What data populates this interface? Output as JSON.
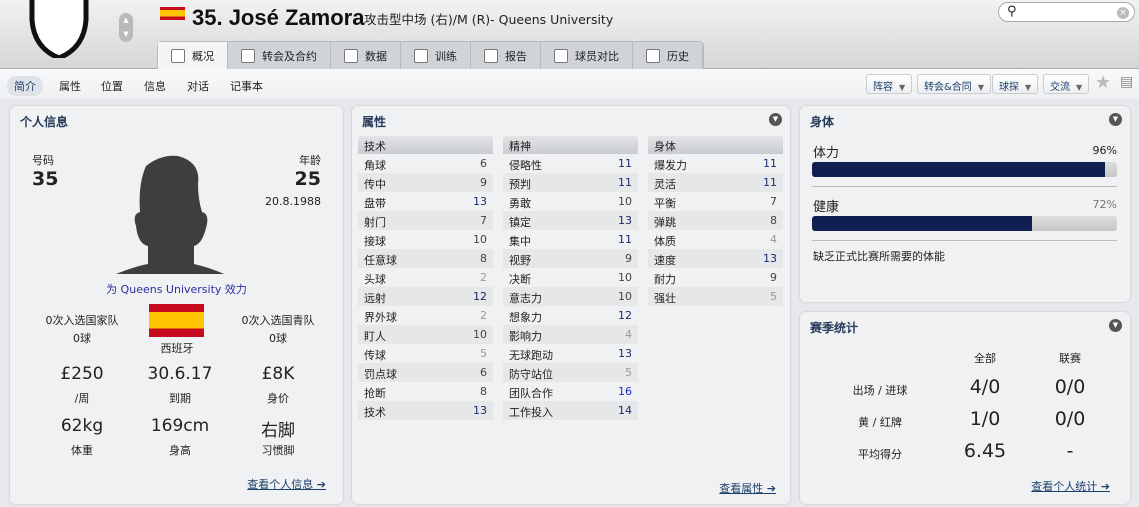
{
  "header": {
    "number_name": "35. José Zamora",
    "position_club": "攻击型中场 (右)/M (R)- Queens University",
    "search_placeholder": ""
  },
  "tabs": [
    {
      "label": "概况",
      "active": true
    },
    {
      "label": "转会及合约"
    },
    {
      "label": "数据"
    },
    {
      "label": "训练"
    },
    {
      "label": "报告"
    },
    {
      "label": "球员对比"
    },
    {
      "label": "历史"
    }
  ],
  "subnav": [
    {
      "label": "简介",
      "active": true
    },
    {
      "label": "属性"
    },
    {
      "label": "位置"
    },
    {
      "label": "信息"
    },
    {
      "label": "对话"
    },
    {
      "label": "记事本"
    }
  ],
  "actions": [
    "阵容",
    "转会&合同",
    "球探",
    "交流"
  ],
  "personal": {
    "title": "个人信息",
    "number_label": "号码",
    "number": "35",
    "age_label": "年龄",
    "age": "25",
    "dob": "20.8.1988",
    "plays_for": "为 Queens University 效力",
    "caps": "0次入选国家队",
    "caps_goals": "0球",
    "nation": "西班牙",
    "youth_caps": "0次入选国青队",
    "youth_goals": "0球",
    "wage": "£250",
    "wage_label": "/周",
    "expiry": "30.6.17",
    "expiry_label": "到期",
    "value": "£8K",
    "value_label": "身价",
    "weight": "62kg",
    "weight_label": "体重",
    "height": "169cm",
    "height_label": "身高",
    "foot": "右脚",
    "foot_label": "习惯脚",
    "link": "查看个人信息"
  },
  "attributes": {
    "title": "属性",
    "link": "查看属性",
    "groups": [
      {
        "name": "技术",
        "items": [
          [
            "角球",
            6
          ],
          [
            "传中",
            9
          ],
          [
            "盘带",
            13
          ],
          [
            "射门",
            7
          ],
          [
            "接球",
            10
          ],
          [
            "任意球",
            8
          ],
          [
            "头球",
            2
          ],
          [
            "远射",
            12
          ],
          [
            "界外球",
            2
          ],
          [
            "盯人",
            10
          ],
          [
            "传球",
            5
          ],
          [
            "罚点球",
            6
          ],
          [
            "抢断",
            8
          ],
          [
            "技术",
            13
          ]
        ]
      },
      {
        "name": "精神",
        "items": [
          [
            "侵略性",
            11
          ],
          [
            "预判",
            11
          ],
          [
            "勇敢",
            10
          ],
          [
            "镇定",
            13
          ],
          [
            "集中",
            11
          ],
          [
            "视野",
            9
          ],
          [
            "决断",
            10
          ],
          [
            "意志力",
            10
          ],
          [
            "想象力",
            12
          ],
          [
            "影响力",
            4
          ],
          [
            "无球跑动",
            13
          ],
          [
            "防守站位",
            5
          ],
          [
            "团队合作",
            16
          ],
          [
            "工作投入",
            14
          ]
        ]
      },
      {
        "name": "身体",
        "items": [
          [
            "爆发力",
            11
          ],
          [
            "灵活",
            11
          ],
          [
            "平衡",
            7
          ],
          [
            "弹跳",
            8
          ],
          [
            "体质",
            4
          ],
          [
            "速度",
            13
          ],
          [
            "耐力",
            9
          ],
          [
            "强壮",
            5
          ]
        ]
      }
    ]
  },
  "physical": {
    "title": "身体",
    "condition_label": "体力",
    "condition": "96%",
    "condition_value": 96,
    "fitness_label": "健康",
    "fitness": "72%",
    "fitness_value": 72,
    "note": "缺乏正式比赛所需要的体能"
  },
  "season": {
    "title": "赛季统计",
    "col_all": "全部",
    "col_league": "联赛",
    "rows": [
      [
        "出场 / 进球",
        "4/0",
        "0/0"
      ],
      [
        "黄 / 红牌",
        "1/0",
        "0/0"
      ],
      [
        "平均得分",
        "6.45",
        "-"
      ]
    ],
    "link": "查看个人统计"
  },
  "colors": {
    "navy": "#0f1f50",
    "link": "#1c3f6e",
    "high": "#1a2a8c"
  }
}
